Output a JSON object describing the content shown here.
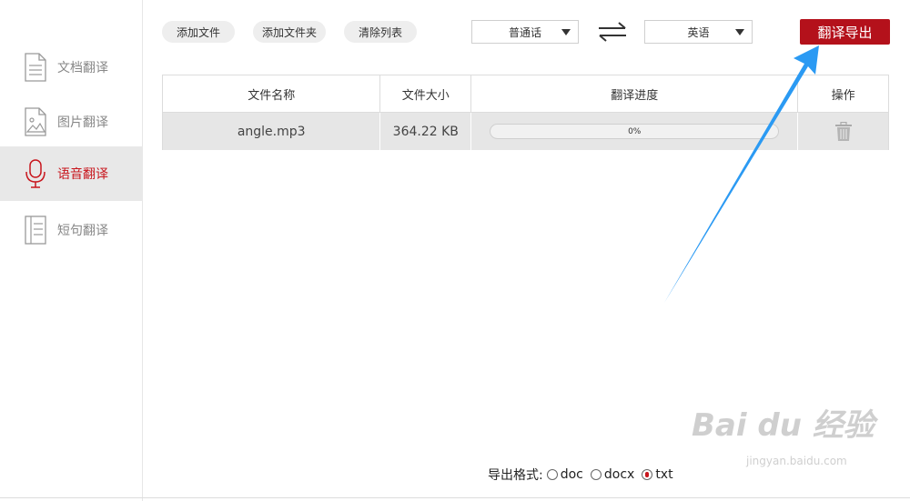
{
  "sidebar": {
    "items": [
      {
        "label": "文档翻译",
        "icon": "document-icon",
        "active": false
      },
      {
        "label": "图片翻译",
        "icon": "image-icon",
        "active": false
      },
      {
        "label": "语音翻译",
        "icon": "microphone-icon",
        "active": true
      },
      {
        "label": "短句翻译",
        "icon": "text-lines-icon",
        "active": false
      }
    ]
  },
  "toolbar": {
    "add_file": "添加文件",
    "add_folder": "添加文件夹",
    "clear_list": "清除列表",
    "source_lang": "普通话",
    "target_lang": "英语",
    "swap_icon": "swap-arrows-icon",
    "export": "翻译导出"
  },
  "table": {
    "headers": [
      "文件名称",
      "文件大小",
      "翻译进度",
      "操作"
    ],
    "rows": [
      {
        "name": "angle.mp3",
        "size": "364.22 KB",
        "progress": "0%",
        "progress_value": 0,
        "action_icon": "trash-icon"
      }
    ]
  },
  "export_format": {
    "label": "导出格式:",
    "options": [
      {
        "label": "doc",
        "checked": false
      },
      {
        "label": "docx",
        "checked": false
      },
      {
        "label": "txt",
        "checked": true
      }
    ]
  },
  "watermark": {
    "text": "Bai du 经验",
    "sub": "jingyan.baidu.com"
  },
  "colors": {
    "accent": "#b4111b",
    "active_text": "#c8161d",
    "annotation_arrow": "#2b9af3"
  }
}
